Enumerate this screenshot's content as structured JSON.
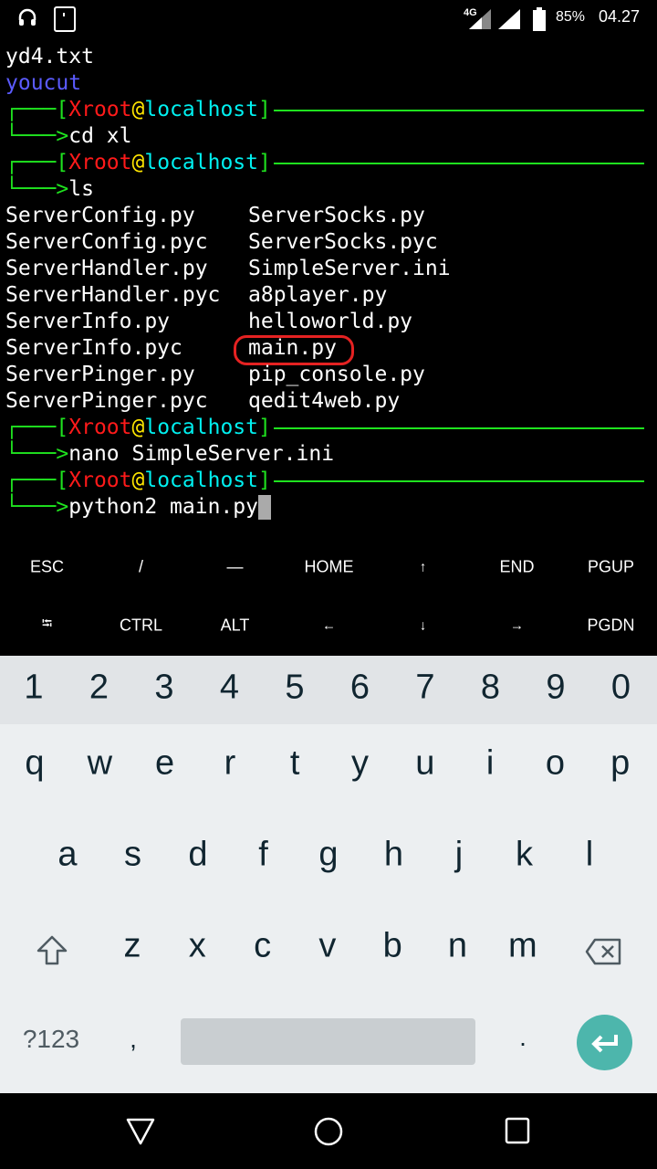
{
  "status": {
    "network": "4G",
    "battery": "85%",
    "time": "04.27"
  },
  "terminal": {
    "pre": [
      "yd4.txt",
      "youcut"
    ],
    "prompt": {
      "corner_top": "┌───",
      "corner_bottom": "└───>",
      "open": "[",
      "user": "Xroot",
      "at": "@",
      "host": "localhost",
      "close": "]"
    },
    "commands": [
      "cd xl",
      "ls",
      "nano SimpleServer.ini",
      "python2 main.py"
    ],
    "ls": [
      [
        "ServerConfig.py",
        "ServerSocks.py"
      ],
      [
        "ServerConfig.pyc",
        "ServerSocks.pyc"
      ],
      [
        "ServerHandler.py",
        "SimpleServer.ini"
      ],
      [
        "ServerHandler.pyc",
        "a8player.py"
      ],
      [
        "ServerInfo.py",
        "helloworld.py"
      ],
      [
        "ServerInfo.pyc",
        "main.py"
      ],
      [
        "ServerPinger.py",
        "pip_console.py"
      ],
      [
        "ServerPinger.pyc",
        "qedit4web.py"
      ]
    ]
  },
  "extra_keys": [
    [
      "ESC",
      "/",
      "—",
      "HOME",
      "↑",
      "END",
      "PGUP"
    ],
    [
      "⭾",
      "CTRL",
      "ALT",
      "←",
      "↓",
      "→",
      "PGDN"
    ]
  ],
  "keyboard": {
    "numbers": [
      "1",
      "2",
      "3",
      "4",
      "5",
      "6",
      "7",
      "8",
      "9",
      "0"
    ],
    "row1": [
      "q",
      "w",
      "e",
      "r",
      "t",
      "y",
      "u",
      "i",
      "o",
      "p"
    ],
    "row2": [
      "a",
      "s",
      "d",
      "f",
      "g",
      "h",
      "j",
      "k",
      "l"
    ],
    "row3": [
      "z",
      "x",
      "c",
      "v",
      "b",
      "n",
      "m"
    ],
    "symbols": "?123",
    "comma": ",",
    "period": "."
  },
  "colors": {
    "accent": "#4db6ac"
  }
}
